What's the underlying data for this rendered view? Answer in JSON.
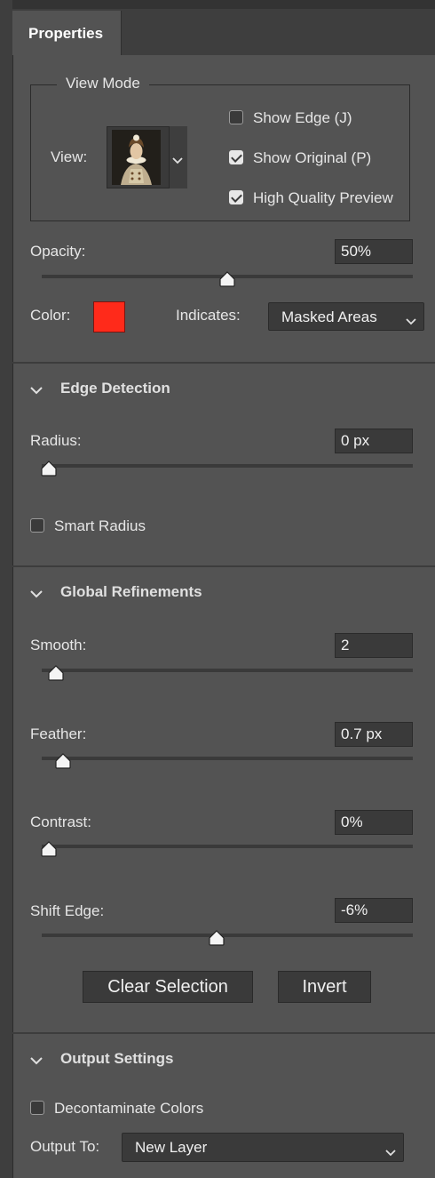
{
  "panel": {
    "tab_label": "Properties"
  },
  "view_mode": {
    "title": "View Mode",
    "view_label": "View:",
    "checkboxes": [
      {
        "label": "Show Edge (J)",
        "checked": false
      },
      {
        "label": "Show Original (P)",
        "checked": true
      },
      {
        "label": "High Quality Preview",
        "checked": true
      }
    ],
    "opacity_label": "Opacity:",
    "opacity_value": "50%",
    "opacity_fraction": 0.5,
    "color_label": "Color:",
    "color_value": "#ff2a1a",
    "indicates_label": "Indicates:",
    "indicates_value": "Masked Areas"
  },
  "edge_detection": {
    "title": "Edge Detection",
    "radius_label": "Radius:",
    "radius_value": "0 px",
    "radius_fraction": 0.0,
    "smart_radius_label": "Smart Radius",
    "smart_radius_checked": false
  },
  "global_refinements": {
    "title": "Global Refinements",
    "smooth_label": "Smooth:",
    "smooth_value": "2",
    "smooth_fraction": 0.02,
    "feather_label": "Feather:",
    "feather_value": "0.7 px",
    "feather_fraction": 0.04,
    "contrast_label": "Contrast:",
    "contrast_value": "0%",
    "contrast_fraction": 0.0,
    "shift_edge_label": "Shift Edge:",
    "shift_edge_value": "-6%",
    "shift_edge_fraction": 0.47,
    "clear_selection_label": "Clear Selection",
    "invert_label": "Invert"
  },
  "output_settings": {
    "title": "Output Settings",
    "decontaminate_label": "Decontaminate Colors",
    "decontaminate_checked": false,
    "output_to_label": "Output To:",
    "output_to_value": "New Layer"
  },
  "icons": {
    "chevron": "chevron-down-icon",
    "check": "checkmark-icon",
    "slider": "slider-thumb-icon"
  }
}
